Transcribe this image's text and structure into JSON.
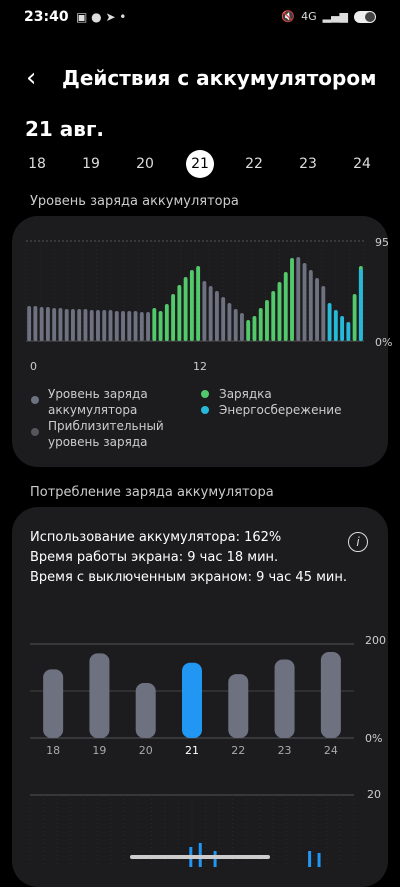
{
  "status": {
    "time": "23:40",
    "notif_icons": "▣ ● ➤ •",
    "network": "4G",
    "signal": "▂▄▆"
  },
  "header": {
    "back_icon": "‹",
    "title": "Действия с аккумулятором"
  },
  "date": "21 авг.",
  "days": [
    {
      "label": "18",
      "selected": false
    },
    {
      "label": "19",
      "selected": false
    },
    {
      "label": "20",
      "selected": false
    },
    {
      "label": "21",
      "selected": true
    },
    {
      "label": "22",
      "selected": false
    },
    {
      "label": "23",
      "selected": false
    },
    {
      "label": "24",
      "selected": false
    }
  ],
  "level_section": {
    "title": "Уровень заряда аккумулятора",
    "y_max_label": "95",
    "y_min_label": "0%",
    "x_labels": [
      "0",
      "12"
    ],
    "legend": {
      "level": "Уровень заряда аккумулятора",
      "approx": "Приблизительный уровень заряда",
      "charging": "Зарядка",
      "saving": "Энергосбережение"
    },
    "colors": {
      "gray": "#6e7180",
      "green": "#52c96a",
      "cyan": "#27b9d9"
    }
  },
  "usage_section": {
    "title": "Потребление заряда аккумулятора",
    "line1": "Использование аккумулятора: 162%",
    "line2": "Время работы экрана: 9 час 18 мин.",
    "line3": "Время с выключенным экраном: 9 час 45 мин.",
    "info_icon": "i",
    "y_max_label": "200",
    "y_min_label": "0%",
    "y_max_label_2": "20"
  },
  "chart_data": [
    {
      "type": "bar",
      "title": "Уровень заряда аккумулятора",
      "xlabel": "",
      "ylabel": "",
      "ylim": [
        0,
        100
      ],
      "x_tick_labels": [
        "0",
        "12"
      ],
      "series": [
        {
          "name": "Уровень заряда аккумулятора",
          "color": "#6e7180",
          "values": [
            35,
            35,
            34,
            34,
            33,
            33,
            32,
            32,
            32,
            32,
            31,
            31,
            31,
            31,
            30,
            30,
            30,
            30,
            29,
            29,
            null,
            null,
            null,
            null,
            null,
            null,
            null,
            null,
            60,
            55,
            50,
            44,
            38,
            32,
            28,
            null,
            null,
            null,
            null,
            null,
            null,
            null,
            null,
            84,
            78,
            71,
            63,
            55,
            null,
            null,
            null,
            null,
            null,
            null
          ]
        },
        {
          "name": "Зарядка",
          "color": "#52c96a",
          "values": [
            null,
            null,
            null,
            null,
            null,
            null,
            null,
            null,
            null,
            null,
            null,
            null,
            null,
            null,
            null,
            null,
            null,
            null,
            null,
            null,
            33,
            30,
            37,
            47,
            56,
            64,
            71,
            75,
            null,
            null,
            null,
            null,
            null,
            null,
            null,
            21,
            25,
            33,
            41,
            50,
            59,
            69,
            83,
            null,
            null,
            null,
            null,
            null,
            null,
            null,
            null,
            null,
            47,
            75
          ]
        },
        {
          "name": "Энергосбережение",
          "color": "#27b9d9",
          "values": [
            null,
            null,
            null,
            null,
            null,
            null,
            null,
            null,
            null,
            null,
            null,
            null,
            null,
            null,
            null,
            null,
            null,
            null,
            null,
            null,
            null,
            null,
            null,
            null,
            null,
            null,
            null,
            null,
            null,
            null,
            null,
            null,
            null,
            null,
            null,
            null,
            null,
            null,
            null,
            null,
            null,
            null,
            null,
            null,
            null,
            null,
            null,
            null,
            38,
            31,
            25,
            19,
            null,
            72
          ]
        }
      ]
    },
    {
      "type": "bar",
      "title": "Потребление заряда аккумулятора",
      "categories": [
        "18",
        "19",
        "20",
        "21",
        "22",
        "23",
        "24"
      ],
      "values": [
        146,
        180,
        117,
        160,
        136,
        167,
        183
      ],
      "highlight_index": 3,
      "ylim": [
        0,
        200
      ],
      "colors": {
        "bar": "#6e7180",
        "selected": "#2196f3"
      }
    }
  ]
}
